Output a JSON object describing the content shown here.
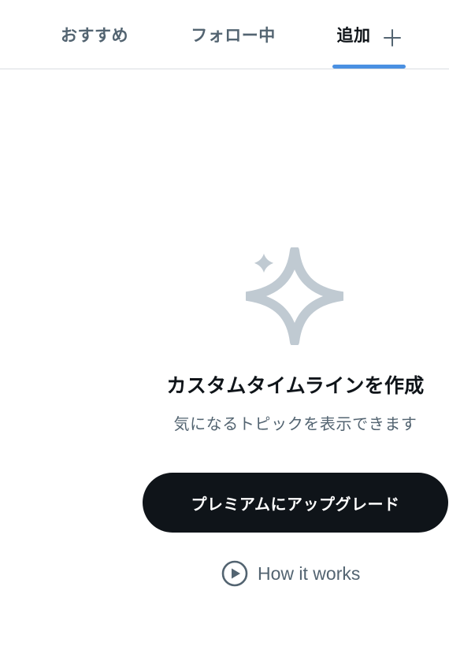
{
  "tabs": [
    {
      "label": "おすすめ",
      "active": false
    },
    {
      "label": "フォロー中",
      "active": false
    },
    {
      "label": "追加",
      "active": true
    }
  ],
  "tab_bar": {
    "add_icon": "plus-icon",
    "indicator_color": "#4a90e2"
  },
  "empty_state": {
    "icon": "sparkle-icon",
    "icon_color": "#c0cad2",
    "heading": "カスタムタイムラインを作成",
    "subtext": "気になるトピックを表示できます",
    "upgrade_label": "プレミアムにアップグレード",
    "how_it_works_icon": "play-circle-icon",
    "how_it_works_label": "How it works"
  },
  "colors": {
    "text_primary": "#0f1419",
    "text_secondary": "#536471",
    "button_bg": "#0f1419",
    "button_text": "#ffffff"
  }
}
